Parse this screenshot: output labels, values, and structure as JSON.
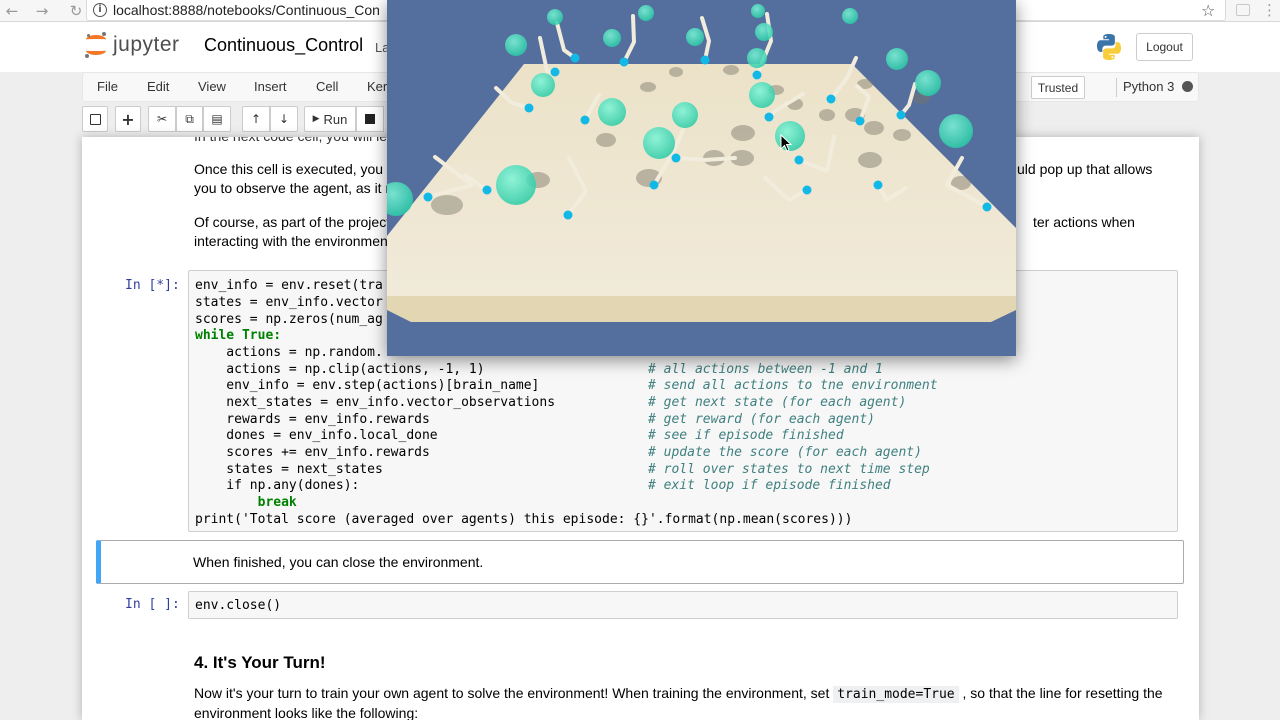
{
  "browser": {
    "url": "localhost:8888/notebooks/Continuous_Con"
  },
  "header": {
    "logo_text": "jupyter",
    "notebook_title": "Continuous_Control",
    "notebook_title_suffix": "La",
    "logout_label": "Logout"
  },
  "menubar": {
    "items": [
      "File",
      "Edit",
      "View",
      "Insert",
      "Cell",
      "Ker"
    ],
    "trusted_label": "Trusted",
    "kernel_name": "Python 3"
  },
  "toolbar": {
    "run_label": "Run"
  },
  "notebook": {
    "partial_line": "In the next code cell, you will lea",
    "para1_line1_left": "Once this cell is executed, you w",
    "para1_line1_right": "uld pop up that allows",
    "para1_line2": "you to observe the agent, as it m",
    "para2_line1_left": "Of course, as part of the project",
    "para2_line1_right": "ter actions when",
    "para2_line2": "interacting with the environment",
    "code_prompt": "In [*]:",
    "code_lines": [
      "env_info = env.reset(tra",
      "states = env_info.vector",
      "scores = np.zeros(num_ag",
      "while True:",
      "    actions = np.random.",
      "    actions = np.clip(actions, -1, 1)",
      "    env_info = env.step(actions)[brain_name]",
      "    next_states = env_info.vector_observations",
      "    rewards = env_info.rewards",
      "    dones = env_info.local_done",
      "    scores += env_info.rewards",
      "    states = next_states",
      "    if np.any(dones):",
      "        break",
      "print('Total score (averaged over agents) this episode: {}'.format(np.mean(scores)))"
    ],
    "comments": [
      "# all actions between -1 and 1",
      "# send all actions to tne environment",
      "# get next state (for each agent)",
      "# get reward (for each agent)",
      "# see if episode finished",
      "# update the score (for each agent)",
      "# roll over states to next time step",
      "# exit loop if episode finished"
    ],
    "md_finished": "When finished, you can close the environment.",
    "close_prompt": "In [ ]:",
    "close_code": "env.close()",
    "heading": "4. It's Your Turn!",
    "turn_line1_pre": "Now it's your turn to train your own agent to solve the environment! When training the environment, set",
    "turn_code": "train_mode=True",
    "turn_line1_post": ", so that the line for resetting the",
    "turn_line2": "environment looks like the following:"
  },
  "colors": {
    "accent_blue": "#42a5f5",
    "unity_background": "#546f9e",
    "arena_floor": "#ebe2c8",
    "agent_sphere": "#2ee0b5"
  }
}
